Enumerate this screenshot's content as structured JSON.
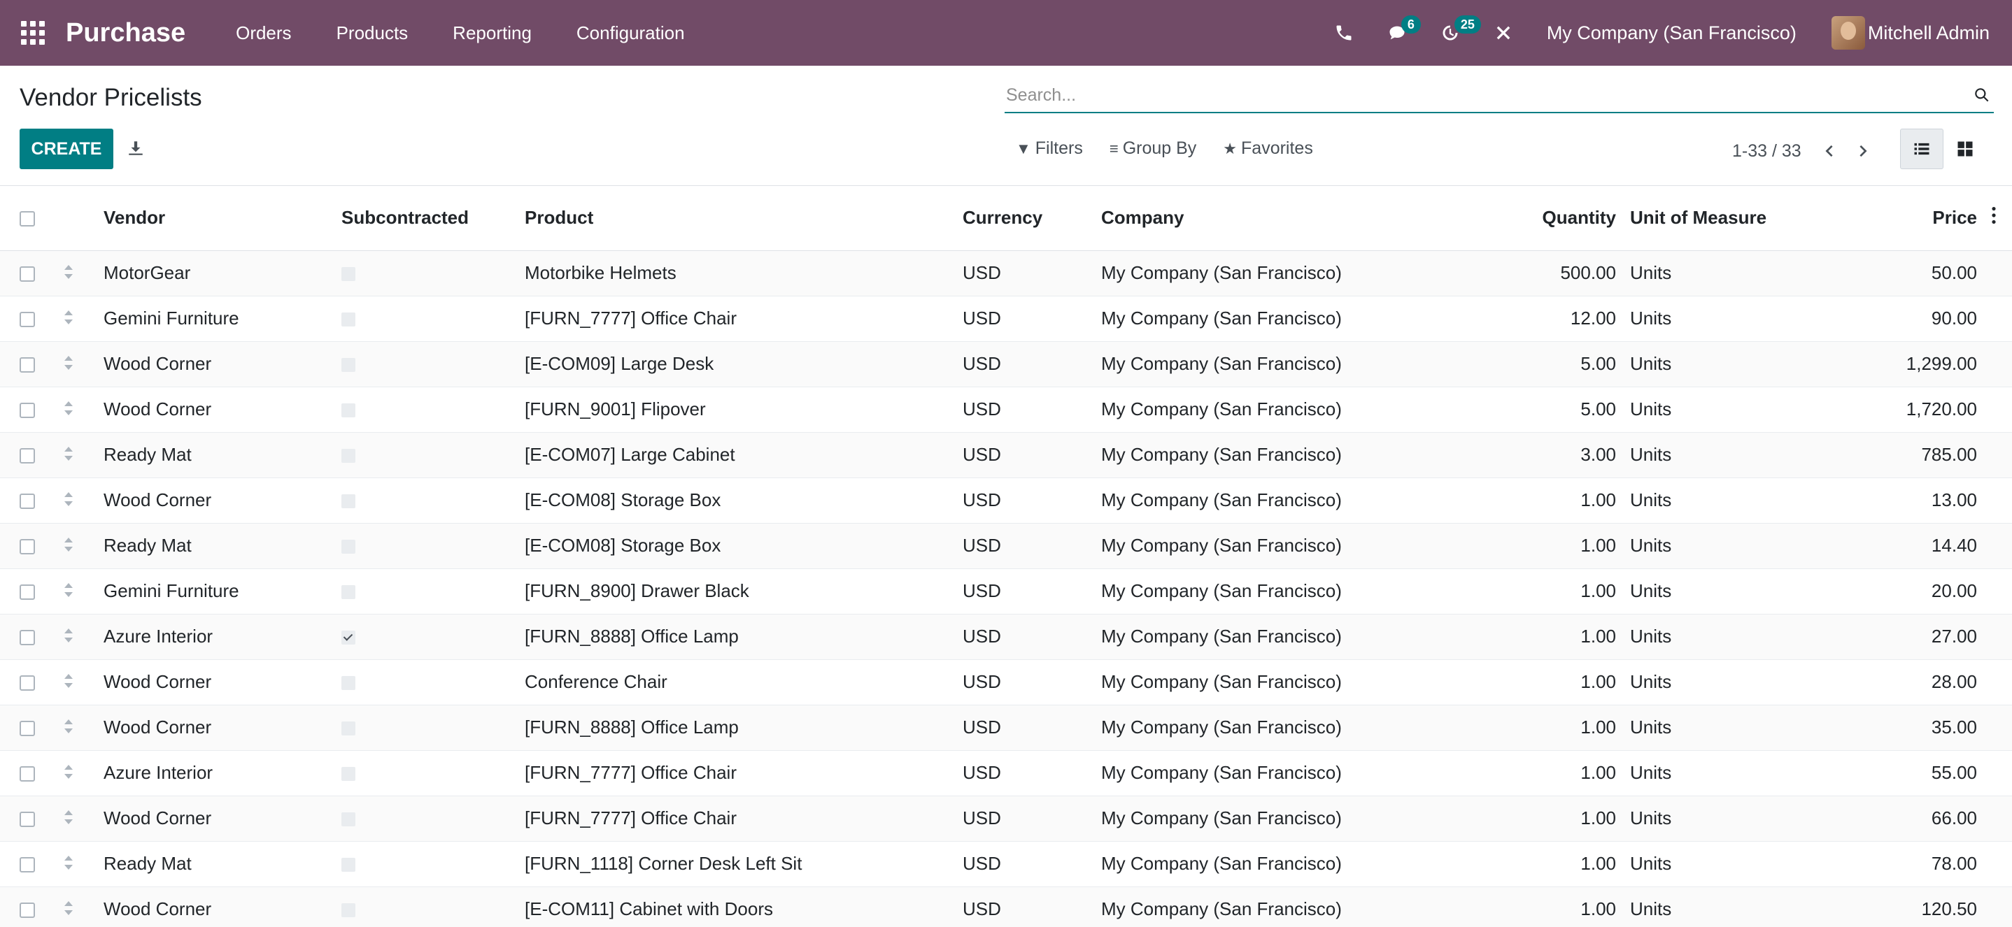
{
  "navbar": {
    "app_name": "Purchase",
    "menu": [
      "Orders",
      "Products",
      "Reporting",
      "Configuration"
    ],
    "messages_badge": "6",
    "activities_badge": "25",
    "company": "My Company (San Francisco)",
    "user": "Mitchell Admin",
    "color": "#714b67"
  },
  "control": {
    "title": "Vendor Pricelists",
    "create_label": "CREATE",
    "search_placeholder": "Search...",
    "filters_label": "Filters",
    "group_by_label": "Group By",
    "favorites_label": "Favorites",
    "pager": "1-33 / 33",
    "accent": "#017e84"
  },
  "table": {
    "headers": {
      "vendor": "Vendor",
      "subcontracted": "Subcontracted",
      "product": "Product",
      "currency": "Currency",
      "company": "Company",
      "quantity": "Quantity",
      "uom": "Unit of Measure",
      "price": "Price"
    },
    "rows": [
      {
        "vendor": "MotorGear",
        "subcontracted": false,
        "product": "Motorbike Helmets",
        "currency": "USD",
        "company": "My Company (San Francisco)",
        "quantity": "500.00",
        "uom": "Units",
        "price": "50.00"
      },
      {
        "vendor": "Gemini Furniture",
        "subcontracted": false,
        "product": "[FURN_7777] Office Chair",
        "currency": "USD",
        "company": "My Company (San Francisco)",
        "quantity": "12.00",
        "uom": "Units",
        "price": "90.00"
      },
      {
        "vendor": "Wood Corner",
        "subcontracted": false,
        "product": "[E-COM09] Large Desk",
        "currency": "USD",
        "company": "My Company (San Francisco)",
        "quantity": "5.00",
        "uom": "Units",
        "price": "1,299.00"
      },
      {
        "vendor": "Wood Corner",
        "subcontracted": false,
        "product": "[FURN_9001] Flipover",
        "currency": "USD",
        "company": "My Company (San Francisco)",
        "quantity": "5.00",
        "uom": "Units",
        "price": "1,720.00"
      },
      {
        "vendor": "Ready Mat",
        "subcontracted": false,
        "product": "[E-COM07] Large Cabinet",
        "currency": "USD",
        "company": "My Company (San Francisco)",
        "quantity": "3.00",
        "uom": "Units",
        "price": "785.00"
      },
      {
        "vendor": "Wood Corner",
        "subcontracted": false,
        "product": "[E-COM08] Storage Box",
        "currency": "USD",
        "company": "My Company (San Francisco)",
        "quantity": "1.00",
        "uom": "Units",
        "price": "13.00"
      },
      {
        "vendor": "Ready Mat",
        "subcontracted": false,
        "product": "[E-COM08] Storage Box",
        "currency": "USD",
        "company": "My Company (San Francisco)",
        "quantity": "1.00",
        "uom": "Units",
        "price": "14.40"
      },
      {
        "vendor": "Gemini Furniture",
        "subcontracted": false,
        "product": "[FURN_8900] Drawer Black",
        "currency": "USD",
        "company": "My Company (San Francisco)",
        "quantity": "1.00",
        "uom": "Units",
        "price": "20.00"
      },
      {
        "vendor": "Azure Interior",
        "subcontracted": true,
        "product": "[FURN_8888] Office Lamp",
        "currency": "USD",
        "company": "My Company (San Francisco)",
        "quantity": "1.00",
        "uom": "Units",
        "price": "27.00"
      },
      {
        "vendor": "Wood Corner",
        "subcontracted": false,
        "product": "Conference Chair",
        "currency": "USD",
        "company": "My Company (San Francisco)",
        "quantity": "1.00",
        "uom": "Units",
        "price": "28.00"
      },
      {
        "vendor": "Wood Corner",
        "subcontracted": false,
        "product": "[FURN_8888] Office Lamp",
        "currency": "USD",
        "company": "My Company (San Francisco)",
        "quantity": "1.00",
        "uom": "Units",
        "price": "35.00"
      },
      {
        "vendor": "Azure Interior",
        "subcontracted": false,
        "product": "[FURN_7777] Office Chair",
        "currency": "USD",
        "company": "My Company (San Francisco)",
        "quantity": "1.00",
        "uom": "Units",
        "price": "55.00"
      },
      {
        "vendor": "Wood Corner",
        "subcontracted": false,
        "product": "[FURN_7777] Office Chair",
        "currency": "USD",
        "company": "My Company (San Francisco)",
        "quantity": "1.00",
        "uom": "Units",
        "price": "66.00"
      },
      {
        "vendor": "Ready Mat",
        "subcontracted": false,
        "product": "[FURN_1118] Corner Desk Left Sit",
        "currency": "USD",
        "company": "My Company (San Francisco)",
        "quantity": "1.00",
        "uom": "Units",
        "price": "78.00"
      },
      {
        "vendor": "Wood Corner",
        "subcontracted": false,
        "product": "[E-COM11] Cabinet with Doors",
        "currency": "USD",
        "company": "My Company (San Francisco)",
        "quantity": "1.00",
        "uom": "Units",
        "price": "120.50"
      }
    ]
  }
}
